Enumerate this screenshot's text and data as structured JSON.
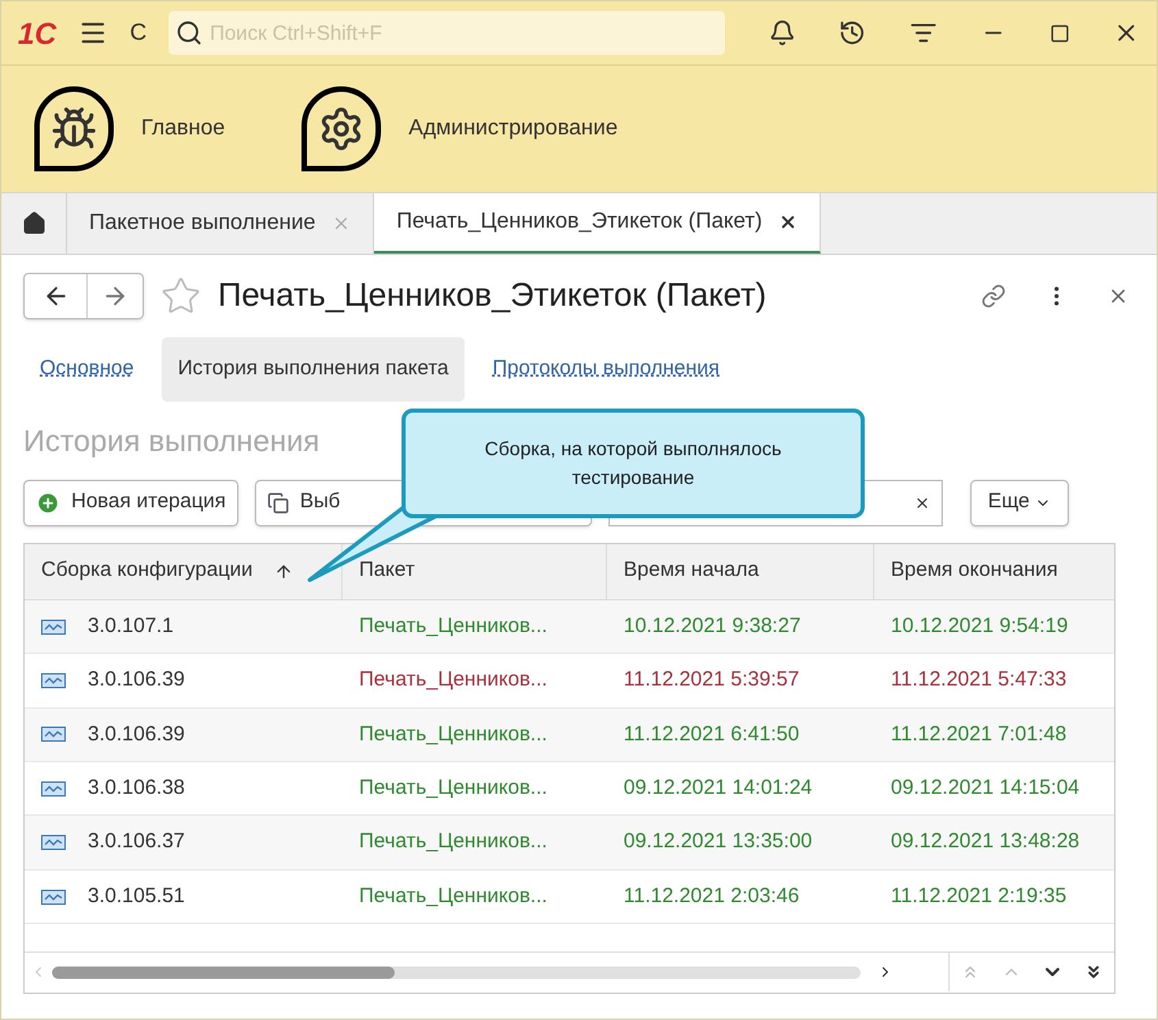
{
  "topbar": {
    "logo": "1С",
    "letter": "С",
    "search": {
      "placeholder": "Поиск Ctrl+Shift+F"
    }
  },
  "sections": [
    {
      "label": "Главное",
      "kind": "bug"
    },
    {
      "label": "Администрирование",
      "kind": "gear"
    }
  ],
  "open_tabs": [
    {
      "label": "Пакетное выполнение",
      "selected": false
    },
    {
      "label": "Печать_Ценников_Этикеток (Пакет)",
      "selected": true
    }
  ],
  "form": {
    "title": "Печать_Ценников_Этикеток (Пакет)",
    "starred": false,
    "subtabs": [
      {
        "label": "Основное",
        "selected": false
      },
      {
        "label": "История выполнения пакета",
        "selected": true
      },
      {
        "label": "Протоколы выполнения",
        "selected": false
      }
    ],
    "section_title": "История выполнения",
    "buttons": {
      "new": "Новая итерация",
      "select": "Выб",
      "more": "Еще"
    },
    "callout": "Сборка, на которой выполнялось тестирование",
    "table": {
      "columns": [
        "Сборка конфигурации",
        "Пакет",
        "Время начала",
        "Время окончания"
      ],
      "rows": [
        {
          "build": "3.0.107.1",
          "package": "Печать_Ценников...",
          "start": "10.12.2021 9:38:27",
          "end": "10.12.2021 9:54:19",
          "color": "#2f8a2f"
        },
        {
          "build": "3.0.106.39",
          "package": "Печать_Ценников...",
          "start": "11.12.2021 5:39:57",
          "end": "11.12.2021 5:47:33",
          "color": "#a8323c"
        },
        {
          "build": "3.0.106.39",
          "package": "Печать_Ценников...",
          "start": "11.12.2021 6:41:50",
          "end": "11.12.2021 7:01:48",
          "color": "#2f8a2f"
        },
        {
          "build": "3.0.106.38",
          "package": "Печать_Ценников...",
          "start": "09.12.2021 14:01:24",
          "end": "09.12.2021 14:15:04",
          "color": "#2f8a2f"
        },
        {
          "build": "3.0.106.37",
          "package": "Печать_Ценников...",
          "start": "09.12.2021 13:35:00",
          "end": "09.12.2021 13:48:28",
          "color": "#2f8a2f"
        },
        {
          "build": "3.0.105.51",
          "package": "Печать_Ценников...",
          "start": "11.12.2021 2:03:46",
          "end": "11.12.2021 2:19:35",
          "color": "#2f8a2f"
        }
      ]
    }
  }
}
